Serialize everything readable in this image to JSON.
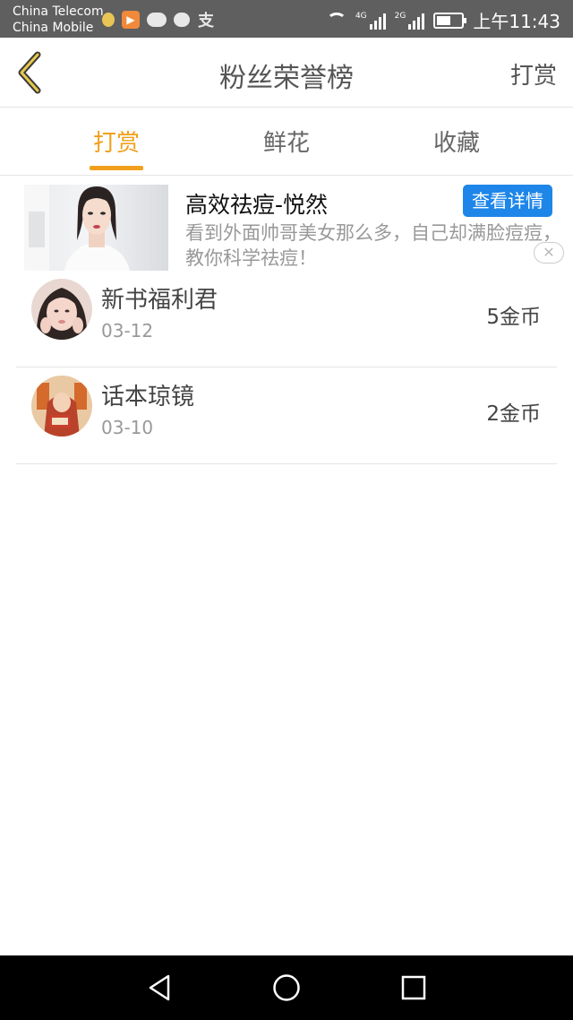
{
  "status_bar": {
    "carrier_1": "China Telecom",
    "carrier_2": "China Mobile",
    "network_1": "4G",
    "network_2": "2G",
    "battery_level": 0.55,
    "time": "上午11:43"
  },
  "header": {
    "title": "粉丝荣誉榜",
    "action": "打赏"
  },
  "tabs": [
    {
      "label": "打赏",
      "active": true
    },
    {
      "label": "鲜花",
      "active": false
    },
    {
      "label": "收藏",
      "active": false
    }
  ],
  "ad": {
    "title": "高效祛痘-悦然",
    "button": "查看详情",
    "description": "看到外面帅哥美女那么多，自己却满脸痘痘，教你科学祛痘！"
  },
  "list": [
    {
      "name": "新书福利君",
      "date": "03-12",
      "amount": "5金币"
    },
    {
      "name": "话本琼镜",
      "date": "03-10",
      "amount": "2金币"
    }
  ],
  "nav_icons": [
    "back-triangle-icon",
    "home-circle-icon",
    "recents-square-icon"
  ],
  "colors": {
    "accent": "#f0a01c",
    "ad_button": "#1e86e8",
    "status_bar": "#5f5f5f"
  }
}
